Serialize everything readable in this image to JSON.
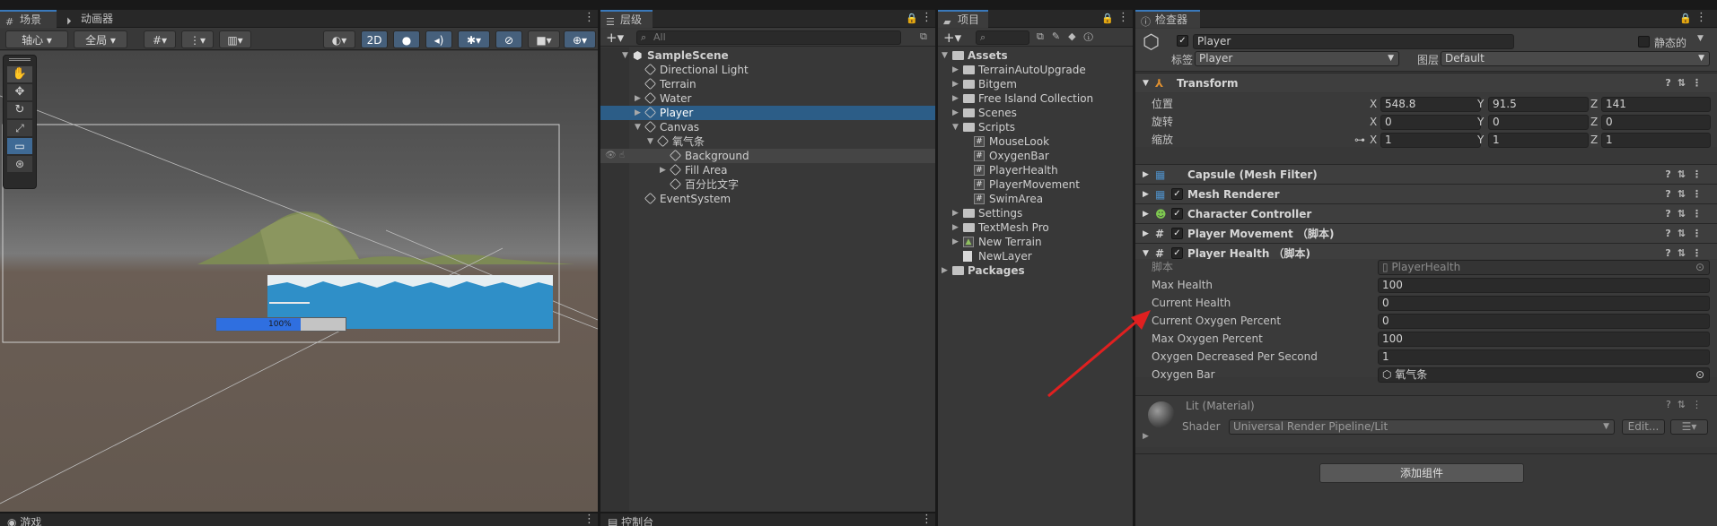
{
  "scene": {
    "tabs": [
      {
        "label": "场景"
      },
      {
        "label": "动画器"
      }
    ],
    "pivot": "轴心",
    "global": "全局",
    "mode_2d": "2D",
    "progress_text": "100%",
    "progress_fraction": 1.0
  },
  "game": {
    "tab": "游戏"
  },
  "console": {
    "tab": "控制台"
  },
  "hierarchy": {
    "tab": "层级",
    "search_placeholder": "All",
    "items": [
      {
        "label": "SampleScene",
        "depth": 0,
        "type": "scene",
        "expanded": true
      },
      {
        "label": "Directional Light",
        "depth": 1,
        "type": "go"
      },
      {
        "label": "Terrain",
        "depth": 1,
        "type": "go"
      },
      {
        "label": "Water",
        "depth": 1,
        "type": "go",
        "collapsed": true
      },
      {
        "label": "Player",
        "depth": 1,
        "type": "go",
        "collapsed": true,
        "selected": true
      },
      {
        "label": "Canvas",
        "depth": 1,
        "type": "go",
        "expanded": true
      },
      {
        "label": "氧气条",
        "depth": 2,
        "type": "go",
        "expanded": true
      },
      {
        "label": "Background",
        "depth": 3,
        "type": "go",
        "hovered": true
      },
      {
        "label": "Fill Area",
        "depth": 3,
        "type": "go",
        "collapsed": true
      },
      {
        "label": "百分比文字",
        "depth": 3,
        "type": "go"
      },
      {
        "label": "EventSystem",
        "depth": 1,
        "type": "go"
      }
    ]
  },
  "project": {
    "tab": "项目",
    "items": [
      {
        "label": "Assets",
        "depth": 0,
        "type": "folder",
        "expanded": true
      },
      {
        "label": "TerrainAutoUpgrade",
        "depth": 1,
        "type": "folder",
        "collapsed": true
      },
      {
        "label": "Bitgem",
        "depth": 1,
        "type": "folder",
        "collapsed": true
      },
      {
        "label": "Free Island Collection",
        "depth": 1,
        "type": "folder",
        "collapsed": true
      },
      {
        "label": "Scenes",
        "depth": 1,
        "type": "folder",
        "collapsed": true
      },
      {
        "label": "Scripts",
        "depth": 1,
        "type": "folder",
        "expanded": true
      },
      {
        "label": "MouseLook",
        "depth": 2,
        "type": "script"
      },
      {
        "label": "OxygenBar",
        "depth": 2,
        "type": "script"
      },
      {
        "label": "PlayerHealth",
        "depth": 2,
        "type": "script"
      },
      {
        "label": "PlayerMovement",
        "depth": 2,
        "type": "script"
      },
      {
        "label": "SwimArea",
        "depth": 2,
        "type": "script"
      },
      {
        "label": "Settings",
        "depth": 1,
        "type": "folder",
        "collapsed": true
      },
      {
        "label": "TextMesh Pro",
        "depth": 1,
        "type": "folder",
        "collapsed": true
      },
      {
        "label": "New Terrain",
        "depth": 1,
        "type": "terrain",
        "collapsed": true
      },
      {
        "label": "NewLayer",
        "depth": 1,
        "type": "file"
      },
      {
        "label": "Packages",
        "depth": 0,
        "type": "folder",
        "collapsed": true
      }
    ]
  },
  "inspector": {
    "tab": "检查器",
    "object_name": "Player",
    "static_label": "静态的",
    "tag_label": "标签",
    "tag_value": "Player",
    "layer_label": "图层",
    "layer_value": "Default",
    "transform": {
      "title": "Transform",
      "rows": [
        {
          "label": "位置",
          "x": "548.8",
          "y": "91.5",
          "z": "141"
        },
        {
          "label": "旋转",
          "x": "0",
          "y": "0",
          "z": "0"
        },
        {
          "label": "缩放",
          "x": "1",
          "y": "1",
          "z": "1"
        }
      ],
      "axis": [
        "X",
        "Y",
        "Z"
      ]
    },
    "components": [
      {
        "title": "Capsule (Mesh Filter)",
        "checkbox": false
      },
      {
        "title": "Mesh Renderer",
        "checkbox": true
      },
      {
        "title": "Character Controller",
        "checkbox": true
      },
      {
        "title": "Player Movement （脚本)",
        "checkbox": true
      },
      {
        "title": "Player Health （脚本)",
        "checkbox": true
      }
    ],
    "player_health": {
      "script_label": "脚本",
      "script_value": "PlayerHealth",
      "fields": [
        {
          "label": "Max Health",
          "value": "100"
        },
        {
          "label": "Current Health",
          "value": "0"
        },
        {
          "label": "Current Oxygen Percent",
          "value": "0"
        },
        {
          "label": "Max Oxygen Percent",
          "value": "100"
        },
        {
          "label": "Oxygen Decreased Per Second",
          "value": "1"
        },
        {
          "label": "Oxygen Bar",
          "value": "氧气条"
        }
      ]
    },
    "material": {
      "name": "Lit (Material)",
      "shader_label": "Shader",
      "shader_value": "Universal Render Pipeline/Lit",
      "edit_label": "Edit..."
    },
    "add_component": "添加组件"
  }
}
